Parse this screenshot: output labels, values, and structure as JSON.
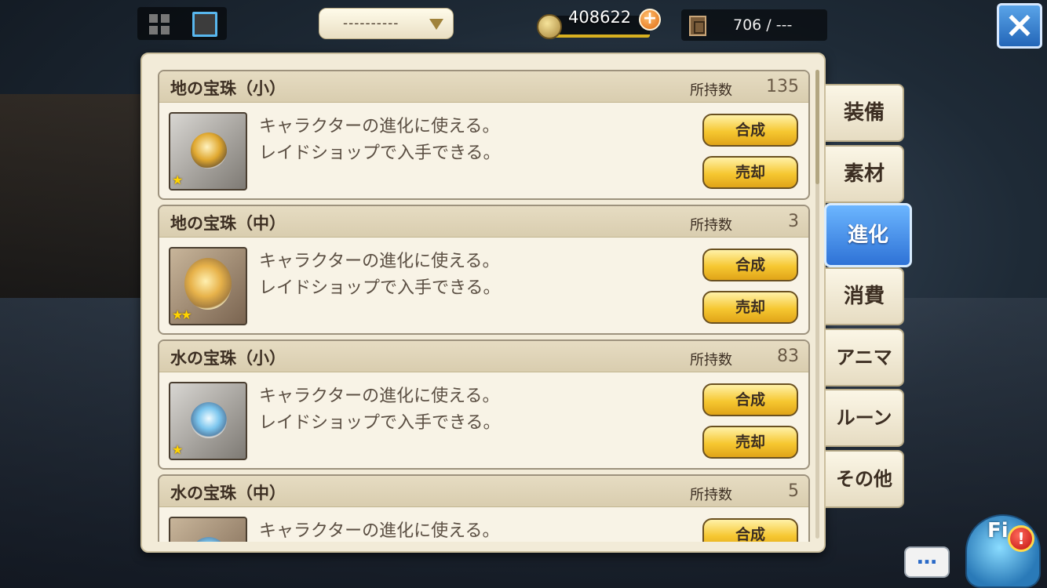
{
  "topbar": {
    "filter_value": "----------",
    "gold": "408622",
    "capacity": "706 / ---"
  },
  "owned_label": "所持数",
  "items": [
    {
      "name": "地の宝珠（小）",
      "owned": "135",
      "desc_line1": "キャラクターの進化に使える。",
      "desc_line2": "レイドショップで入手できる。",
      "stars": "★",
      "synth": "合成",
      "sell": "売却"
    },
    {
      "name": "地の宝珠（中）",
      "owned": "3",
      "desc_line1": "キャラクターの進化に使える。",
      "desc_line2": "レイドショップで入手できる。",
      "stars": "★★",
      "synth": "合成",
      "sell": "売却"
    },
    {
      "name": "水の宝珠（小）",
      "owned": "83",
      "desc_line1": "キャラクターの進化に使える。",
      "desc_line2": "レイドショップで入手できる。",
      "stars": "★",
      "synth": "合成",
      "sell": "売却"
    },
    {
      "name": "水の宝珠（中）",
      "owned": "5",
      "desc_line1": "キャラクターの進化に使える。",
      "desc_line2": "",
      "stars": "",
      "synth": "合成",
      "sell": ""
    }
  ],
  "tabs": [
    {
      "label": "装備"
    },
    {
      "label": "素材"
    },
    {
      "label": "進化",
      "active": true
    },
    {
      "label": "消費"
    },
    {
      "label": "アニマ"
    },
    {
      "label": "ルーン"
    },
    {
      "label": "その他"
    }
  ],
  "chat_label": "…",
  "mascot_label": "Fi",
  "alert_label": "!",
  "plus_label": "+"
}
